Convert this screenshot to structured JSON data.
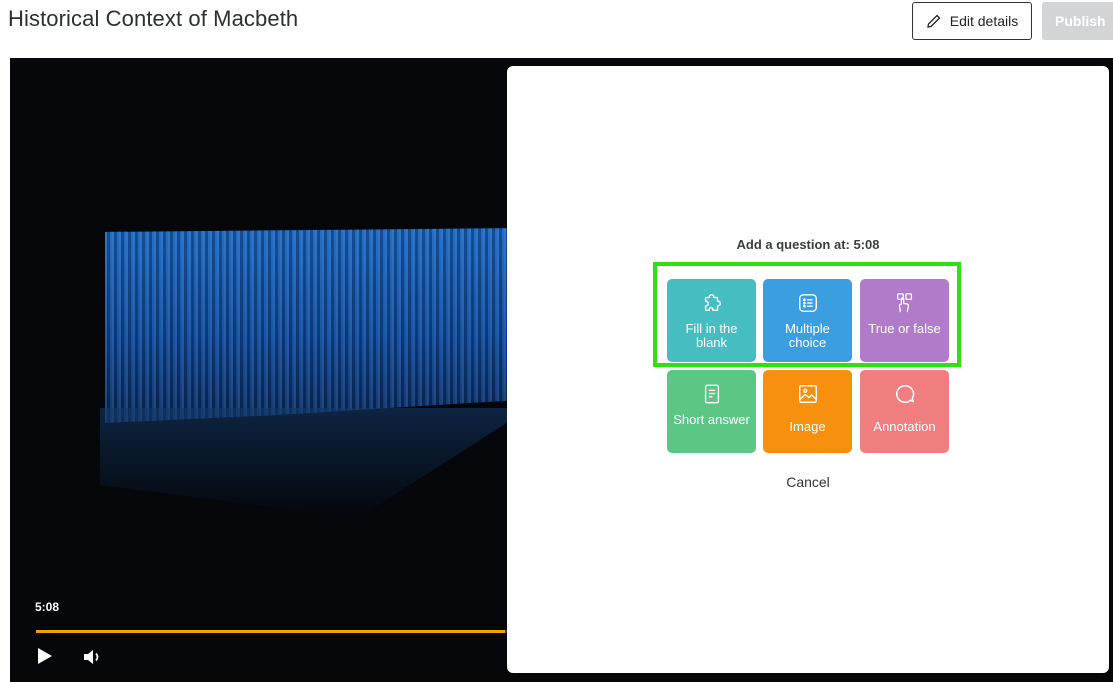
{
  "header": {
    "title": "Historical Context of Macbeth",
    "edit_label": "Edit details",
    "publish_label": "Publish"
  },
  "player": {
    "current_time": "5:08",
    "progress_fraction": 0.44,
    "accent_color": "#f39c12"
  },
  "dialog": {
    "heading": "Add a question at: 5:08",
    "options": [
      {
        "label": "Fill in the blank",
        "icon": "puzzle-icon",
        "color": "#45bdc1"
      },
      {
        "label": "Multiple choice",
        "icon": "list-icon",
        "color": "#3b9ee0"
      },
      {
        "label": "True or false",
        "icon": "touch-choice-icon",
        "color": "#b07cca"
      },
      {
        "label": "Short answer",
        "icon": "document-icon",
        "color": "#5cc685"
      },
      {
        "label": "Image",
        "icon": "image-icon",
        "color": "#f7910d"
      },
      {
        "label": "Annotation",
        "icon": "speech-bubble-icon",
        "color": "#f17e7e"
      }
    ],
    "highlight_color": "#2fe00f",
    "cancel_label": "Cancel"
  }
}
